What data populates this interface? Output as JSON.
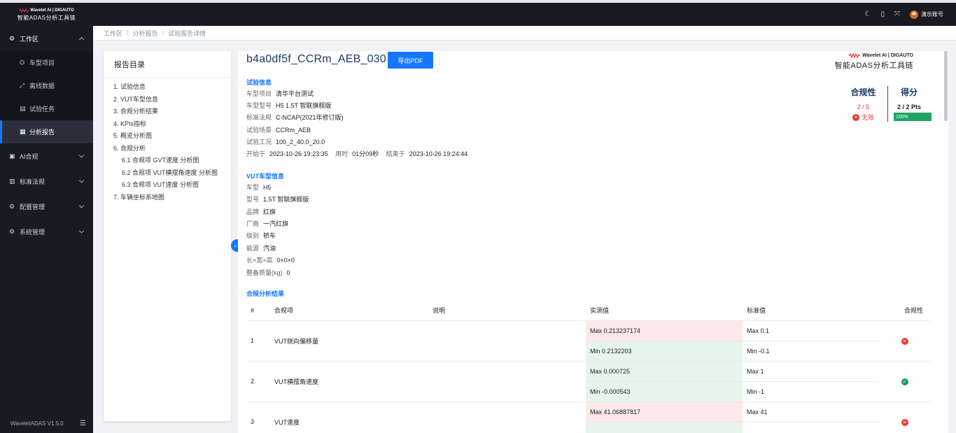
{
  "app": {
    "logo_brand": "Wavelet AI | DIGAUTO",
    "logo_title": "智能ADAS分析工具链",
    "version": "WaveletADAS  V1.5.0"
  },
  "sidebar": {
    "workspace": "工作区",
    "items": [
      {
        "label": "车型项目",
        "icon": "car-icon"
      },
      {
        "label": "离线数据",
        "icon": "data-icon"
      },
      {
        "label": "试验任务",
        "icon": "task-icon"
      },
      {
        "label": "分析报告",
        "icon": "report-icon"
      }
    ],
    "groups": [
      {
        "label": "AI合规",
        "icon": "ai-icon"
      },
      {
        "label": "标准法规",
        "icon": "standard-icon"
      },
      {
        "label": "配置管理",
        "icon": "config-icon"
      },
      {
        "label": "系统管理",
        "icon": "system-icon"
      }
    ]
  },
  "topbar": {
    "user": "演示账号"
  },
  "breadcrumb": [
    "工作区",
    "分析报告",
    "试验报告详情"
  ],
  "toc": {
    "title": "报告目录",
    "items": [
      "1. 试验信息",
      "2. VUT车型信息",
      "3. 合规分析结果",
      "4. KPIs指标",
      "5. 概览分析图",
      "6. 合规分析",
      "6.1 合规项 GVT速度 分析图",
      "6.2 合规项 VUT横摆角速度 分析图",
      "6.3 合规项 VUT速度 分析图",
      "7. 车辆坐标系地图"
    ]
  },
  "report": {
    "title": "b4a0df5f_CCRm_AEB_030",
    "export": "导出PDF",
    "brand_top": "Wavelet AI | DIGAUTO",
    "brand_bottom": "智能ADAS分析工具链"
  },
  "test_info": {
    "heading": "试验信息",
    "project_k": "车型项目",
    "project_v": "清华平台测试",
    "model_k": "车型型号",
    "model_v": "H5 1.5T 智联旗舰版",
    "std_k": "标准法规",
    "std_v": "C-NCAP(2021年修订版)",
    "scene_k": "试验场景",
    "scene_v": "CCRm_AEB",
    "cond_k": "试验工况",
    "cond_v": "100_2_40.0_20.0",
    "start_k": "开始于",
    "start_v": "2023-10-26 19:23:35",
    "dur_k": "用时",
    "dur_v": "01分09秒",
    "end_k": "结束于",
    "end_v": "2023-10-26 19:24:44"
  },
  "vut_info": {
    "heading": "VUT车型信息",
    "rows": [
      {
        "k": "车型",
        "v": "H5"
      },
      {
        "k": "型号",
        "v": "1.5T 智联旗舰版"
      },
      {
        "k": "品牌",
        "v": "红旗"
      },
      {
        "k": "厂商",
        "v": "一汽红旗"
      },
      {
        "k": "级别",
        "v": "轿车"
      },
      {
        "k": "能源",
        "v": "汽油"
      },
      {
        "k": "长×宽×高",
        "v": "0×0×0"
      },
      {
        "k": "整备质量(kg)",
        "v": "0"
      }
    ]
  },
  "score": {
    "compliance_label": "合规性",
    "compliance_value": "2 / 5",
    "compliance_status": "无效",
    "score_label": "得分",
    "score_value": "2 / 2 Pts",
    "score_percent": "100%"
  },
  "compliance": {
    "heading": "合规分析结果",
    "columns": [
      "#",
      "合规项",
      "说明",
      "实测值",
      "标准值",
      "合规性"
    ],
    "rows": [
      {
        "no": "1",
        "item": "VUT侧向偏移量",
        "desc": "",
        "m1": "Max 0.213237174",
        "s1": "Max 0.1",
        "m2": "Min 0.2132203",
        "s2": "Min -0.1",
        "ok": false
      },
      {
        "no": "2",
        "item": "VUT横摆角速度",
        "desc": "",
        "m1": "Max 0.000725",
        "s1": "Max 1",
        "m2": "Min -0.000543",
        "s2": "Min -1",
        "ok": true
      },
      {
        "no": "3",
        "item": "VUT速度",
        "desc": "",
        "m1": "Max 41.06887817",
        "s1": "Max 41",
        "m2": "",
        "s2": "",
        "ok": false
      }
    ]
  }
}
